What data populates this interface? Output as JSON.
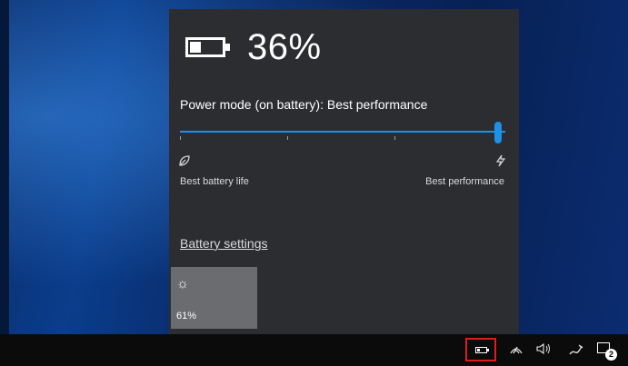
{
  "battery_flyout": {
    "percent": "36%",
    "battery_level": 0.36,
    "power_mode_label": "Power mode (on battery): ",
    "power_mode_value": "Best performance",
    "slider_value": 1.0,
    "left_end_label": "Best battery life",
    "right_end_label": "Best performance",
    "settings_link": "Battery settings",
    "brightness_tile": {
      "icon": "brightness-icon",
      "value": "61%"
    }
  },
  "taskbar": {
    "tray_icons": [
      "battery-icon",
      "wifi-icon",
      "volume-icon",
      "pen-icon",
      "notifications-icon"
    ],
    "notification_count": "2",
    "highlight_color": "#e41919"
  },
  "colors": {
    "accent": "#1e90e6",
    "flyout_bg": "#2b2d30",
    "tile_bg": "#6a6c6f"
  }
}
